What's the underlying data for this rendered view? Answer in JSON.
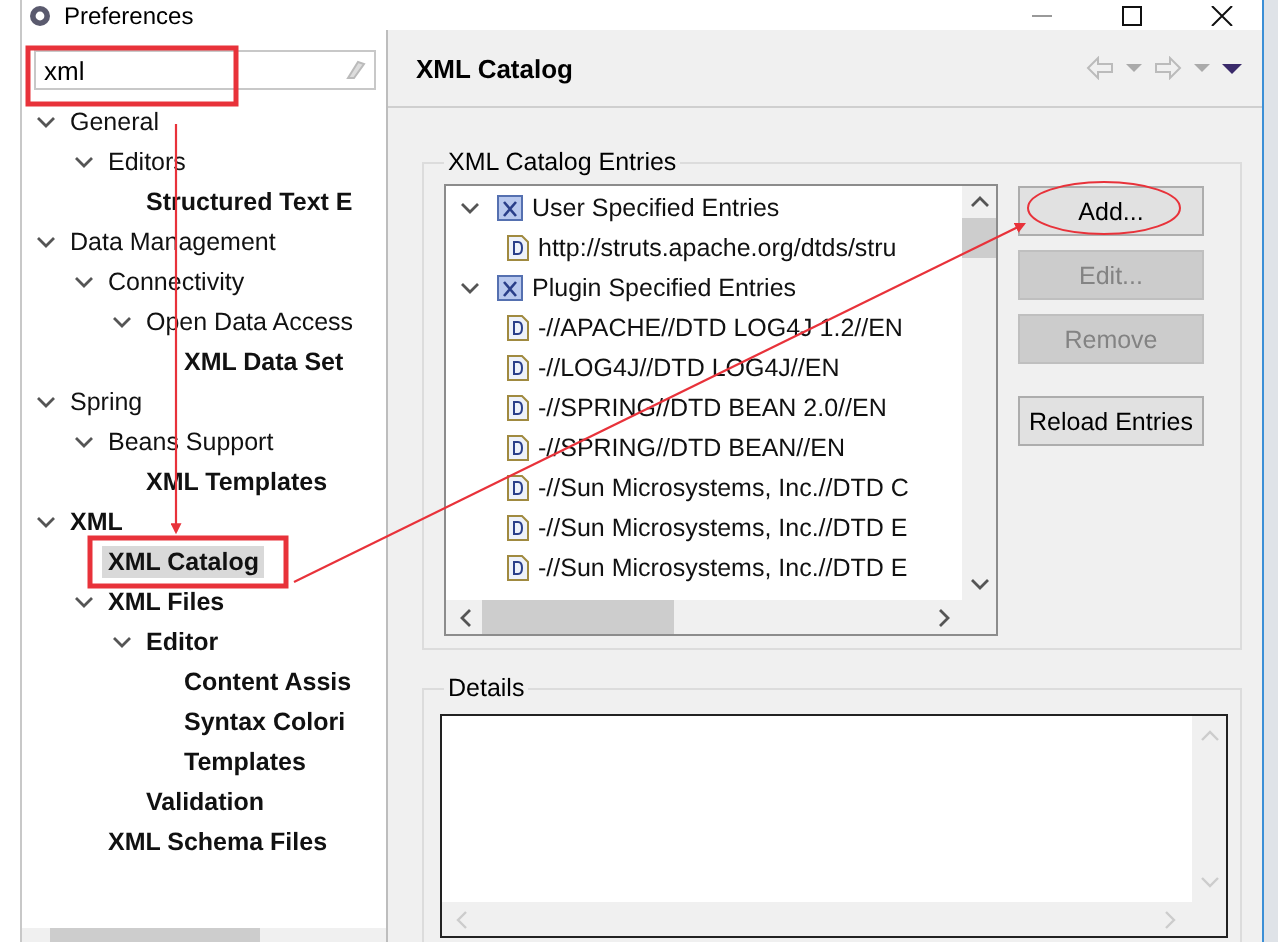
{
  "window": {
    "title": "Preferences"
  },
  "search": {
    "value": "xml"
  },
  "tree": [
    {
      "label": "General",
      "expanded": true,
      "matched": false,
      "selected": false,
      "children": [
        {
          "label": "Editors",
          "expanded": true,
          "matched": false,
          "selected": false,
          "children": [
            {
              "label": "Structured Text E",
              "matched": true,
              "selected": false
            }
          ]
        }
      ]
    },
    {
      "label": "Data Management",
      "expanded": true,
      "matched": false,
      "selected": false,
      "children": [
        {
          "label": "Connectivity",
          "expanded": true,
          "matched": false,
          "selected": false,
          "children": [
            {
              "label": "Open Data Access",
              "expanded": true,
              "matched": false,
              "selected": false,
              "children": [
                {
                  "label": "XML Data Set",
                  "matched": true,
                  "selected": false
                }
              ]
            }
          ]
        }
      ]
    },
    {
      "label": "Spring",
      "expanded": true,
      "matched": false,
      "selected": false,
      "children": [
        {
          "label": "Beans Support",
          "expanded": true,
          "matched": false,
          "selected": false,
          "children": [
            {
              "label": "XML Templates",
              "matched": true,
              "selected": false
            }
          ]
        }
      ]
    },
    {
      "label": "XML",
      "expanded": true,
      "matched": true,
      "selected": false,
      "children": [
        {
          "label": "XML Catalog",
          "matched": true,
          "selected": true
        },
        {
          "label": "XML Files",
          "expanded": true,
          "matched": true,
          "selected": false,
          "children": [
            {
              "label": "Editor",
              "expanded": true,
              "matched": true,
              "selected": false,
              "children": [
                {
                  "label": "Content Assis",
                  "matched": true,
                  "selected": false
                },
                {
                  "label": "Syntax Colori",
                  "matched": true,
                  "selected": false
                },
                {
                  "label": "Templates",
                  "matched": true,
                  "selected": false
                }
              ]
            },
            {
              "label": "Validation",
              "matched": true,
              "selected": false
            }
          ]
        },
        {
          "label": "XML Schema Files",
          "matched": true,
          "selected": false
        }
      ]
    }
  ],
  "page": {
    "title": "XML Catalog"
  },
  "entries_group": {
    "title": "XML Catalog Entries",
    "entries": [
      {
        "label": "User Specified Entries",
        "kind": "catalog",
        "expanded": true,
        "children": [
          {
            "label": "http://struts.apache.org/dtds/stru",
            "kind": "dtd"
          }
        ]
      },
      {
        "label": "Plugin Specified Entries",
        "kind": "catalog",
        "expanded": true,
        "children": [
          {
            "label": "-//APACHE//DTD LOG4J 1.2//EN",
            "kind": "dtd"
          },
          {
            "label": "-//LOG4J//DTD LOG4J//EN",
            "kind": "dtd"
          },
          {
            "label": "-//SPRING//DTD BEAN 2.0//EN",
            "kind": "dtd"
          },
          {
            "label": "-//SPRING//DTD BEAN//EN",
            "kind": "dtd"
          },
          {
            "label": "-//Sun Microsystems, Inc.//DTD C",
            "kind": "dtd"
          },
          {
            "label": "-//Sun Microsystems, Inc.//DTD E",
            "kind": "dtd"
          },
          {
            "label": "-//Sun Microsystems, Inc.//DTD E",
            "kind": "dtd"
          }
        ]
      }
    ],
    "buttons": [
      {
        "label": "Add...",
        "disabled": false
      },
      {
        "label": "Edit...",
        "disabled": true
      },
      {
        "label": "Remove",
        "disabled": true
      },
      {
        "label": "Reload Entries",
        "disabled": false
      }
    ]
  },
  "details_group": {
    "title": "Details"
  }
}
